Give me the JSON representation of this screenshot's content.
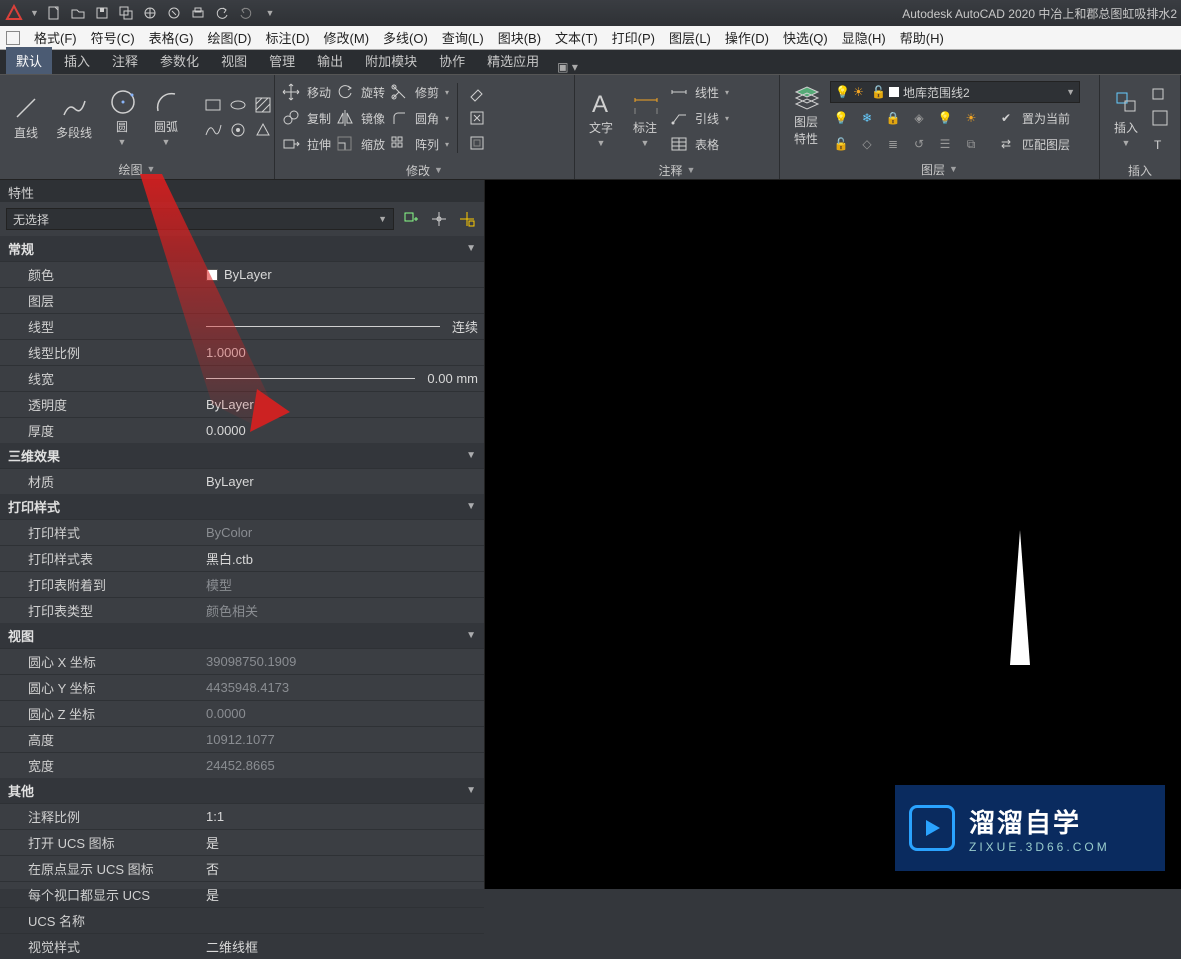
{
  "titlebar": {
    "app_title": "Autodesk AutoCAD 2020   中冶上和郡总图虹吸排水2"
  },
  "menubar": {
    "items": [
      "格式(F)",
      "符号(C)",
      "表格(G)",
      "绘图(D)",
      "标注(D)",
      "修改(M)",
      "多线(O)",
      "查询(L)",
      "图块(B)",
      "文本(T)",
      "打印(P)",
      "图层(L)",
      "操作(D)",
      "快选(Q)",
      "显隐(H)",
      "帮助(H)"
    ]
  },
  "ribbon_tabs": {
    "items": [
      "默认",
      "插入",
      "注释",
      "参数化",
      "视图",
      "管理",
      "输出",
      "附加模块",
      "协作",
      "精选应用"
    ],
    "active_index": 0
  },
  "ribbon": {
    "draw": {
      "label": "绘图",
      "tools": [
        "直线",
        "多段线",
        "圆",
        "圆弧"
      ]
    },
    "modify": {
      "label": "修改",
      "col1": [
        [
          "移动",
          "move-icon"
        ],
        [
          "复制",
          "copy-icon"
        ],
        [
          "拉伸",
          "stretch-icon"
        ]
      ],
      "col2": [
        [
          "旋转",
          "rotate-icon"
        ],
        [
          "镜像",
          "mirror-icon"
        ],
        [
          "缩放",
          "scale-icon"
        ]
      ],
      "col3": [
        [
          "修剪",
          "trim-icon"
        ],
        [
          "圆角",
          "fillet-icon"
        ],
        [
          "阵列",
          "array-icon"
        ]
      ]
    },
    "annotate": {
      "label": "注释",
      "text": "文字",
      "dim": "标注",
      "col": [
        [
          "线性",
          "linear-dim-icon"
        ],
        [
          "引线",
          "leader-icon"
        ],
        [
          "表格",
          "table-icon"
        ]
      ]
    },
    "layer": {
      "label": "图层",
      "props": "图层\n特性",
      "combo_value": "地库范围线2",
      "set_current": "置为当前",
      "match_layer": "匹配图层"
    },
    "block": {
      "label": "插入",
      "tool": "插入"
    }
  },
  "properties": {
    "panel_title": "特性",
    "selection": "无选择",
    "sections": {
      "general": {
        "title": "常规",
        "rows": [
          {
            "k": "颜色",
            "v": "ByLayer",
            "swatch": true
          },
          {
            "k": "图层",
            "v": ""
          },
          {
            "k": "线型",
            "v": "连续",
            "line": true
          },
          {
            "k": "线型比例",
            "v": "1.0000"
          },
          {
            "k": "线宽",
            "v": "0.00 mm",
            "lw": true
          },
          {
            "k": "透明度",
            "v": "ByLayer"
          },
          {
            "k": "厚度",
            "v": "0.0000"
          }
        ]
      },
      "threed": {
        "title": "三维效果",
        "rows": [
          {
            "k": "材质",
            "v": "ByLayer"
          }
        ]
      },
      "plot": {
        "title": "打印样式",
        "rows": [
          {
            "k": "打印样式",
            "v": "ByColor",
            "dim": true
          },
          {
            "k": "打印样式表",
            "v": "黑白.ctb"
          },
          {
            "k": "打印表附着到",
            "v": "模型",
            "dim": true
          },
          {
            "k": "打印表类型",
            "v": "颜色相关",
            "dim": true
          }
        ]
      },
      "view": {
        "title": "视图",
        "rows": [
          {
            "k": "圆心 X 坐标",
            "v": "39098750.1909",
            "dim": true
          },
          {
            "k": "圆心 Y 坐标",
            "v": "4435948.4173",
            "dim": true
          },
          {
            "k": "圆心 Z 坐标",
            "v": "0.0000",
            "dim": true
          },
          {
            "k": "高度",
            "v": "10912.1077",
            "dim": true
          },
          {
            "k": "宽度",
            "v": "24452.8665",
            "dim": true
          }
        ]
      },
      "misc": {
        "title": "其他",
        "rows": [
          {
            "k": "注释比例",
            "v": "1:1"
          },
          {
            "k": "打开 UCS 图标",
            "v": "是"
          },
          {
            "k": "在原点显示 UCS 图标",
            "v": "否"
          },
          {
            "k": "每个视口都显示 UCS",
            "v": "是"
          },
          {
            "k": "UCS 名称",
            "v": ""
          },
          {
            "k": "视觉样式",
            "v": "二维线框"
          }
        ]
      }
    }
  },
  "badge": {
    "t1": "溜溜自学",
    "t2": "ZIXUE.3D66.COM"
  }
}
